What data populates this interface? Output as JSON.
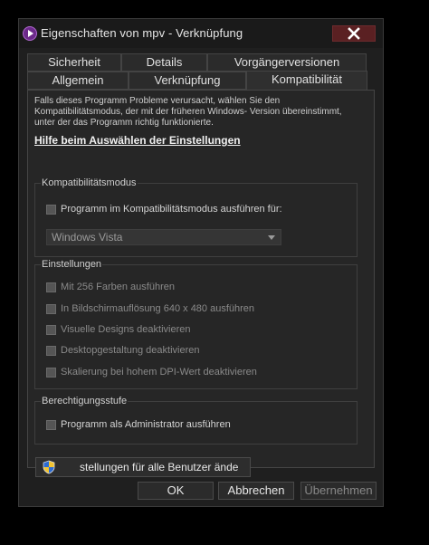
{
  "window": {
    "title": "Eigenschaften von mpv - Verknüpfung",
    "app_icon": "mpv-icon",
    "close_icon": "close-icon"
  },
  "tabs": {
    "row1": [
      {
        "label": "Sicherheit"
      },
      {
        "label": "Details"
      },
      {
        "label": "Vorgängerversionen"
      }
    ],
    "row2": [
      {
        "label": "Allgemein"
      },
      {
        "label": "Verknüpfung"
      },
      {
        "label": "Kompatibilität",
        "active": true
      }
    ]
  },
  "compat": {
    "intro": "Falls dieses Programm Probleme verursacht, wählen Sie den Kompatibilitätsmodus, der mit der früheren Windows- Version übereinstimmt, unter der das Programm richtig funktionierte.",
    "help_link": "Hilfe beim Auswählen der Einstellungen",
    "mode_group": {
      "label": "Kompatibilitätsmodus",
      "checkbox_label": "Programm im Kompatibilitätsmodus ausführen für:",
      "checked": false,
      "selected_os": "Windows Vista"
    },
    "settings_group": {
      "label": "Einstellungen",
      "items": [
        {
          "label": "Mit 256 Farben ausführen",
          "checked": false
        },
        {
          "label": "In Bildschirmauflösung 640 x 480 ausführen",
          "checked": false
        },
        {
          "label": "Visuelle Designs deaktivieren",
          "checked": false
        },
        {
          "label": "Desktopgestaltung deaktivieren",
          "checked": false
        },
        {
          "label": "Skalierung bei hohem DPI-Wert deaktivieren",
          "checked": false
        }
      ]
    },
    "privilege_group": {
      "label": "Berechtigungsstufe",
      "checkbox_label": "Programm als Administrator ausführen",
      "checked": false
    },
    "all_users_button": {
      "label": "stellungen für alle Benutzer ände",
      "icon": "uac-shield-icon"
    }
  },
  "footer": {
    "ok": "OK",
    "cancel": "Abbrechen",
    "apply": "Übernehmen"
  }
}
